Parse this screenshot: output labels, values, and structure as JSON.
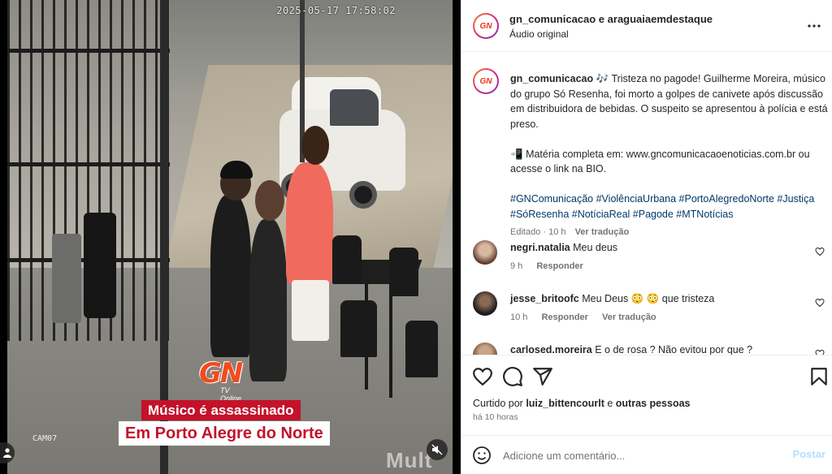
{
  "video": {
    "timestamp": "2025-05-17 17:58:02",
    "camera_label": "CAM07",
    "logo_text": "GN",
    "logo_sub": "TV Online",
    "headline_line1": "Músico é assassinado",
    "headline_line2": "Em Porto Alegre do Norte",
    "watermark": "Mult",
    "mute_icon": "speaker-muted-icon",
    "user_tag_icon": "person-icon"
  },
  "header": {
    "title": "gn_comunicacao e araguaiaemdestaque",
    "subtitle": "Áudio original",
    "more_icon": "more-horizontal-icon"
  },
  "caption": {
    "username": "gn_comunicacao",
    "music_emoji": "🎶",
    "text": "Tristeza no pagode! Guilherme Moreira, músico do grupo Só Resenha, foi morto a golpes de canivete após discussão em distribuidora de bebidas. O suspeito se apresentou à polícia e está preso.",
    "link_emoji": "📲",
    "link_text": "Matéria completa em: www.gncomunicacaoenoticias.com.br ou acesse o link na BIO.",
    "hashtags": "#GNComunicação #ViolênciaUrbana #PortoAlegredoNorte #Justiça #SóResenha #NotíciaReal #Pagode #MTNotícias",
    "edited": "Editado",
    "time": "10 h",
    "see_translation": "Ver tradução"
  },
  "comments": [
    {
      "username": "negri.natalia",
      "text": "Meu deus",
      "time": "9 h",
      "reply": "Responder",
      "translate": ""
    },
    {
      "username": "jesse_britoofc",
      "text": "Meu Deus 😳 😳  que tristeza",
      "time": "10 h",
      "reply": "Responder",
      "translate": "Ver tradução"
    },
    {
      "username": "carlosed.moreira",
      "text": "E o de rosa ? Não evitou por que ?",
      "time": "",
      "reply": "",
      "translate": ""
    }
  ],
  "actions": {
    "like_icon": "heart-icon",
    "comment_icon": "comment-bubble-icon",
    "share_icon": "paper-plane-icon",
    "save_icon": "bookmark-icon"
  },
  "likes": {
    "prefix": "Curtido por",
    "user": "luiz_bittencourlt",
    "joiner": "e",
    "others": "outras pessoas",
    "when": "há 10 horas"
  },
  "add_comment": {
    "placeholder": "Adicione um comentário...",
    "post_label": "Postar",
    "emoji_icon": "emoji-smile-icon"
  },
  "colors": {
    "link": "#00376b",
    "muted": "#737373",
    "banner_red": "#c3122a",
    "post_disabled": "#b2dffc"
  }
}
